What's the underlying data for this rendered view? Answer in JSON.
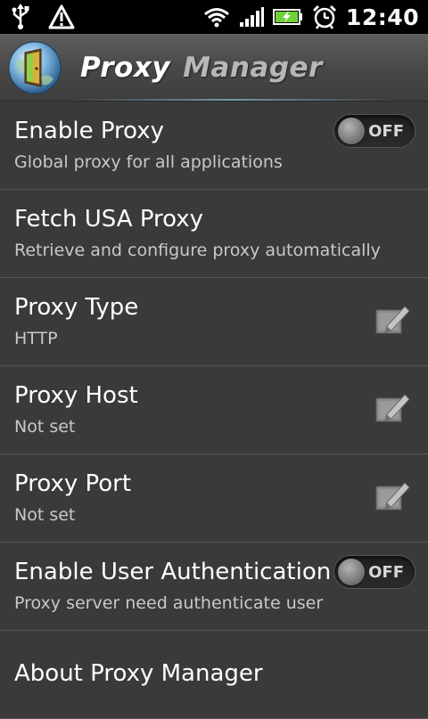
{
  "status_bar": {
    "time": "12:40",
    "icons": [
      "usb-icon",
      "warning-icon",
      "wifi-icon",
      "signal-icon",
      "battery-charging-icon",
      "alarm-icon"
    ]
  },
  "app": {
    "title_word1": "Proxy",
    "title_word2": "Manager",
    "logo_icon": "globe-door-icon"
  },
  "settings": [
    {
      "title": "Enable Proxy",
      "summary": "Global proxy for all applications",
      "control": "toggle",
      "toggle_label": "OFF"
    },
    {
      "title": "Fetch USA Proxy",
      "summary": "Retrieve and configure proxy automatically"
    },
    {
      "title": "Proxy Type",
      "summary": "HTTP",
      "control": "edit-icon"
    },
    {
      "title": "Proxy Host",
      "summary": "Not set",
      "control": "edit-icon"
    },
    {
      "title": "Proxy Port",
      "summary": "Not set",
      "control": "edit-icon"
    },
    {
      "title": "Enable User Authentication",
      "summary": "Proxy server need authenticate user",
      "control": "toggle",
      "toggle_label": "OFF"
    },
    {
      "title": "About Proxy Manager"
    }
  ],
  "colors": {
    "background": "#3a3a3a",
    "status_bar": "#000000",
    "divider": "#545454",
    "summary_text": "#c8c8c8",
    "battery_green": "#6fd13a"
  }
}
